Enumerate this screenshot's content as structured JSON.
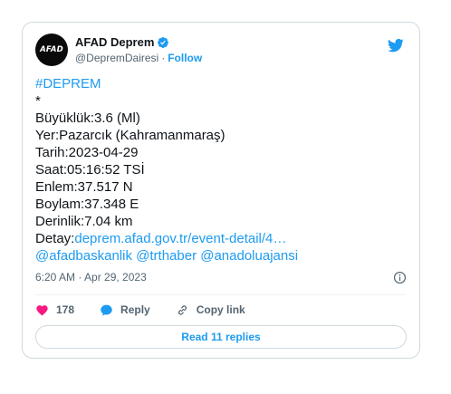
{
  "account": {
    "avatar_text": "AFAD",
    "display_name": "AFAD Deprem",
    "handle": "@DepremDairesi",
    "separator": "·",
    "follow_label": "Follow"
  },
  "tweet": {
    "lines": [
      "#DEPREM",
      "*",
      "Büyüklük:3.6 (Ml)",
      "Yer:Pazarcık (Kahramanmaraş)",
      "Tarih:2023-04-29",
      "Saat:05:16:52 TSİ",
      "Enlem:37.517 N",
      "Boylam:37.348 E",
      "Derinlik:7.04 km"
    ],
    "detail_prefix": "Detay:",
    "detail_link": "deprem.afad.gov.tr/event-detail/4…",
    "mentions": [
      "@afadbaskanlik",
      "@trthaber",
      "@anadoluajansi"
    ],
    "timestamp": "6:20 AM · Apr 29, 2023"
  },
  "actions": {
    "like_count": "178",
    "reply_label": "Reply",
    "copy_link_label": "Copy link"
  },
  "read_replies_label": "Read 11 replies",
  "colors": {
    "accent": "#1d9bf0",
    "like": "#f91880",
    "text": "#0f1419",
    "muted": "#536471",
    "border": "#cfd9de"
  }
}
